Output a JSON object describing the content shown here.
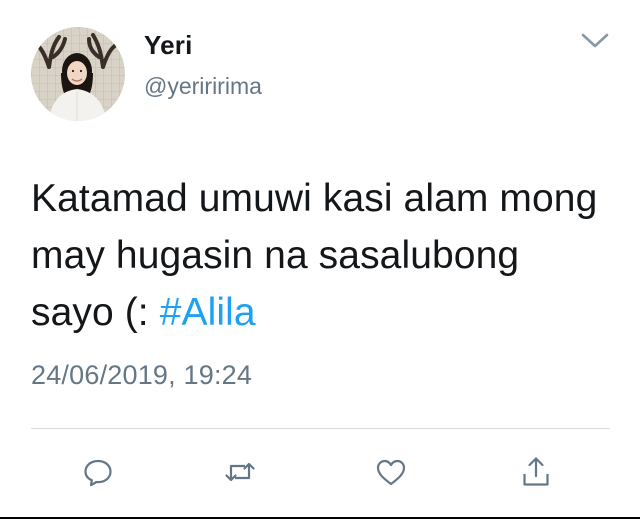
{
  "user": {
    "display_name": "Yeri",
    "handle": "@yeriririma",
    "avatar": "profile-photo"
  },
  "tweet": {
    "text_before": "Katamad umuwi kasi alam mong may hugasin na sasalubong sayo (: ",
    "hashtag": "#Alila",
    "timestamp": "24/06/2019, 19:24"
  },
  "actions": {
    "icons": [
      "reply-icon",
      "retweet-icon",
      "like-icon",
      "share-icon"
    ]
  },
  "colors": {
    "text": "#14171a",
    "secondary": "#657786",
    "link": "#1da1f2",
    "divider": "#d8dde1"
  }
}
